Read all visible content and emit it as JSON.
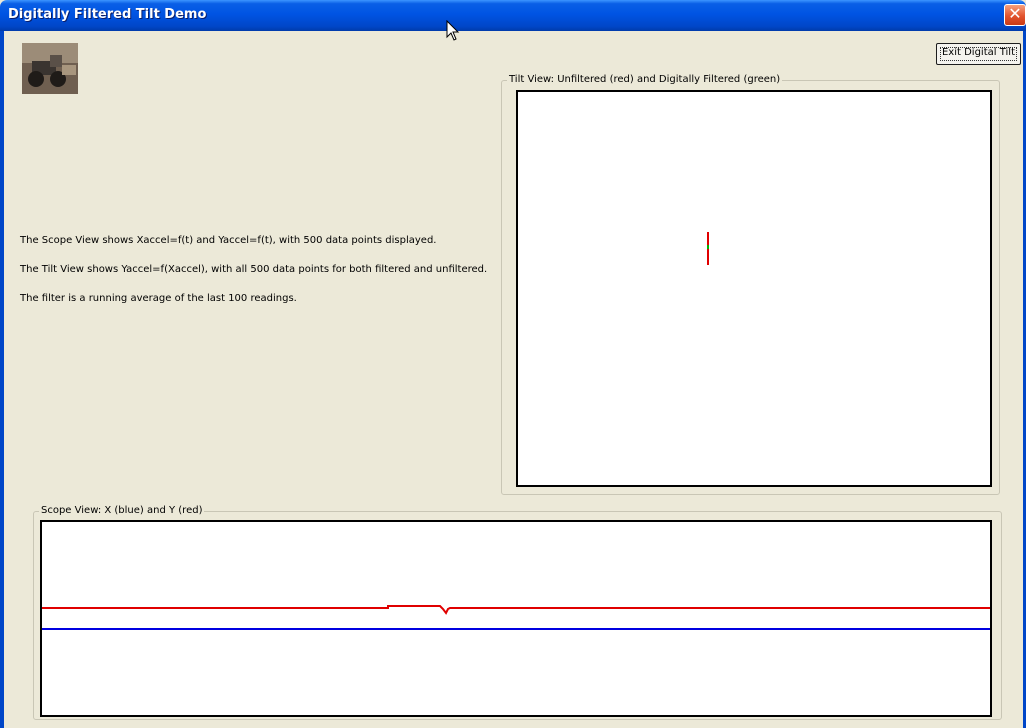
{
  "window": {
    "title": "Digitally Filtered Tilt Demo",
    "close_icon": "close-icon"
  },
  "toolbar": {
    "exit_label": "Exit Digital Tilt"
  },
  "description": {
    "line1": "The Scope View shows Xaccel=f(t) and Yaccel=f(t), with 500 data points displayed.",
    "line2": "The Tilt View shows Yaccel=f(Xaccel), with all 500 data points for both filtered and unfiltered.",
    "line3": "The filter is a running average of the last 100 readings."
  },
  "tilt_view": {
    "label": "Tilt View: Unfiltered (red) and Digitally Filtered (green)",
    "unfiltered_color": "#E00000",
    "filtered_color": "#00B000"
  },
  "scope_view": {
    "label": "Scope View: X (blue) and Y (red)",
    "x_color": "#0000E0",
    "y_color": "#E00000"
  }
}
